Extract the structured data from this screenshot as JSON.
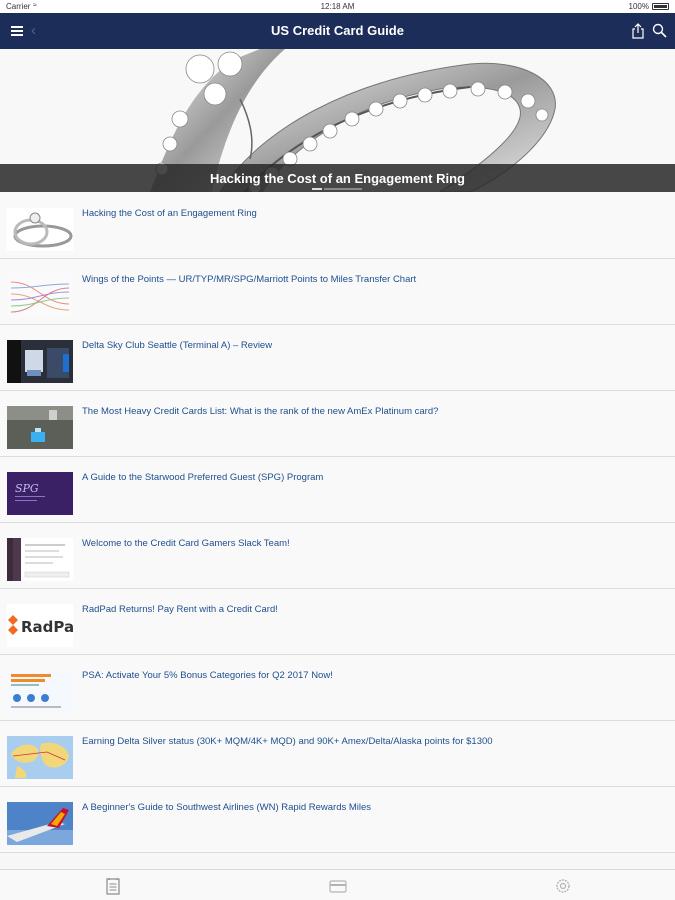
{
  "status_bar": {
    "carrier": "Carrier",
    "time": "12:18 AM",
    "battery": "100%"
  },
  "nav": {
    "title": "US Credit Card Guide"
  },
  "hero": {
    "caption": "Hacking the Cost of an Engagement Ring"
  },
  "articles": [
    {
      "title": "Hacking the Cost of an Engagement Ring",
      "thumb": "ring-thumbnail"
    },
    {
      "title": "Wings of the Points — UR/TYP/MR/SPG/Marriott Points to Miles Transfer Chart",
      "thumb": "transfer-chart-thumbnail"
    },
    {
      "title": "Delta Sky Club Seattle (Terminal A) – Review",
      "thumb": "lounge-thumbnail"
    },
    {
      "title": "The Most Heavy Credit Cards List: What is the rank of the new AmEx Platinum card?",
      "thumb": "scale-thumbnail"
    },
    {
      "title": "A Guide to the Starwood Preferred Guest (SPG) Program",
      "thumb": "spg-thumbnail"
    },
    {
      "title": "Welcome to the Credit Card Gamers Slack Team!",
      "thumb": "slack-thumbnail"
    },
    {
      "title": "RadPad Returns! Pay Rent with a Credit Card!",
      "thumb": "radpad-thumbnail",
      "thumb_text": "RadPad"
    },
    {
      "title": "PSA: Activate Your 5% Bonus Categories for Q2 2017 Now!",
      "thumb": "bonus-thumbnail"
    },
    {
      "title": "Earning Delta Silver status (30K+ MQM/4K+ MQD) and 90K+ Amex/Delta/Alaska points for $1300",
      "thumb": "map-thumbnail"
    },
    {
      "title": "A Beginner's Guide to Southwest Airlines (WN) Rapid Rewards Miles",
      "thumb": "southwest-thumbnail"
    }
  ],
  "tabs": [
    {
      "icon": "articles-icon"
    },
    {
      "icon": "credit-card-icon"
    },
    {
      "icon": "settings-icon"
    }
  ],
  "colors": {
    "nav_bg": "#1b2d58",
    "link": "#1f4f8f",
    "radpad_orange": "#f26a21"
  }
}
